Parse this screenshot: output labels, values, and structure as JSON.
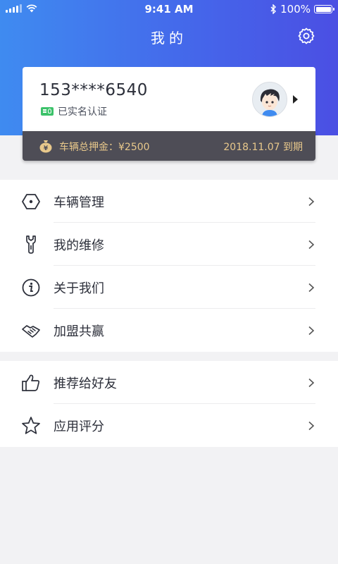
{
  "status_bar": {
    "time": "9:41 AM",
    "battery": "100%"
  },
  "header": {
    "title": "我的",
    "settings_icon": "gear-icon"
  },
  "profile": {
    "phone": "153****6540",
    "verify_text": "已实名认证"
  },
  "deposit": {
    "label": "车辆总押金：¥2500",
    "expiry": "2018.11.07 到期"
  },
  "menu_group1": [
    {
      "label": "车辆管理",
      "icon": "hexagon-icon"
    },
    {
      "label": "我的维修",
      "icon": "wrench-icon"
    },
    {
      "label": "关于我们",
      "icon": "info-icon"
    },
    {
      "label": "加盟共赢",
      "icon": "handshake-icon"
    }
  ],
  "menu_group2": [
    {
      "label": "推荐给好友",
      "icon": "thumbs-up-icon"
    },
    {
      "label": "应用评分",
      "icon": "star-icon"
    }
  ],
  "colors": {
    "header_start": "#3f8bf0",
    "header_end": "#4b4fe3",
    "gold": "#e8c88b",
    "verify_green": "#3cc26a"
  }
}
